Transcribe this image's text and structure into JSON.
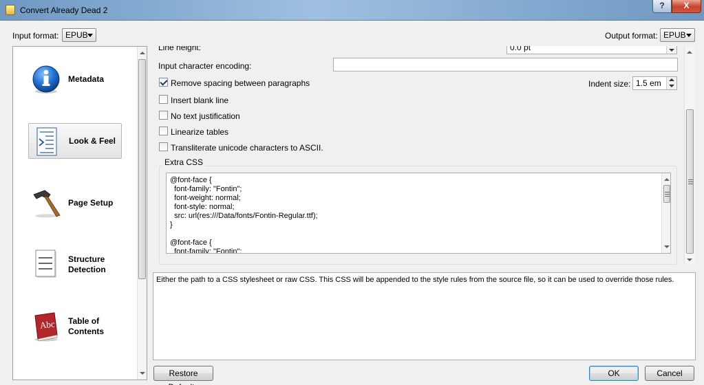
{
  "window": {
    "title": "Convert Already Dead 2",
    "help_label": "?",
    "close_label": "X"
  },
  "formats": {
    "input_label": "Input format:",
    "input_value": "EPUB",
    "output_label": "Output format:",
    "output_value": "EPUB"
  },
  "sidebar": {
    "items": [
      {
        "label_line1": "Metadata",
        "label_line2": "",
        "icon": "info-icon"
      },
      {
        "label_line1": "Look & Feel",
        "label_line2": "",
        "icon": "look-feel-icon",
        "selected": true
      },
      {
        "label_line1": "Page Setup",
        "label_line2": "",
        "icon": "hammer-icon"
      },
      {
        "label_line1": "Structure",
        "label_line2": "Detection",
        "icon": "document-icon"
      },
      {
        "label_line1": "Table of",
        "label_line2": "Contents",
        "icon": "abc-book-icon"
      }
    ]
  },
  "look_feel": {
    "line_height_label": "Line height:",
    "line_height_value": "0.0 pt",
    "encoding_label": "Input character encoding:",
    "encoding_value": "",
    "remove_spacing_label": "Remove spacing between paragraphs",
    "remove_spacing_checked": true,
    "indent_size_label": "Indent size:",
    "indent_size_value": "1.5 em",
    "insert_blank_label": "Insert blank line",
    "no_justification_label": "No text justification",
    "linearize_label": "Linearize tables",
    "transliterate_label": "Transliterate unicode characters to ASCII.",
    "extra_css_label": "Extra CSS",
    "extra_css_text": "@font-face {\n  font-family: \"Fontin\";\n  font-weight: normal;\n  font-style: normal;\n  src: url(res:///Data/fonts/Fontin-Regular.ttf);\n}\n\n@font-face {\n  font-family: \"Fontin\";"
  },
  "help": {
    "text": "Either the path to a CSS stylesheet or raw CSS. This CSS will be appended to the style rules from the source file, so it can be used to override those rules."
  },
  "buttons": {
    "restore_defaults": "Restore Defaults",
    "ok": "OK",
    "cancel": "Cancel"
  }
}
